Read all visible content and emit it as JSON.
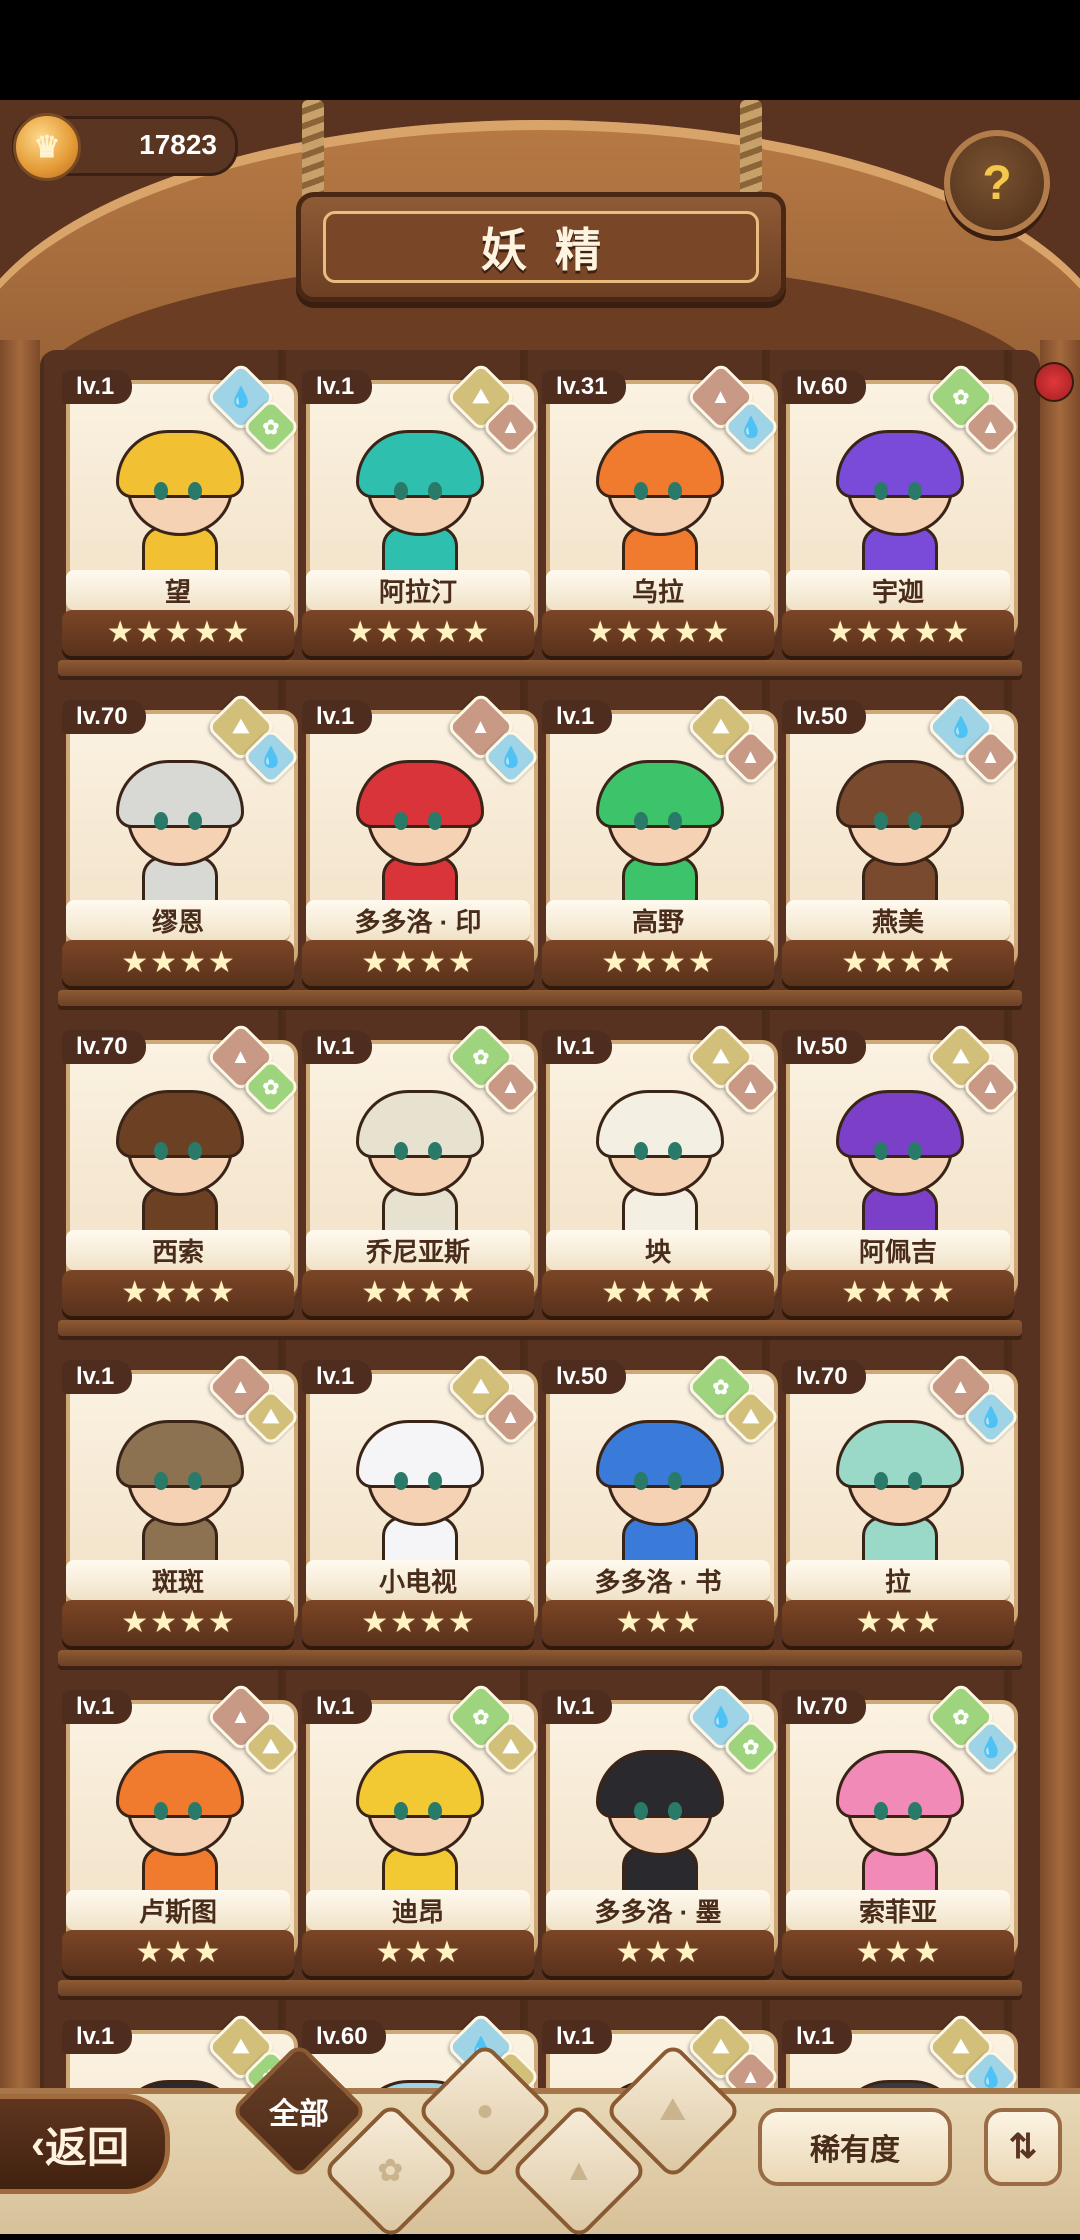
{
  "currency": {
    "value": "17823",
    "icon": "coin-icon"
  },
  "title": "妖精",
  "help": {
    "label": "?"
  },
  "fairies": [
    {
      "lv": "lv.1",
      "name": "望",
      "stars": 5,
      "hair": "#f2c033",
      "elem_big": "water",
      "elem_small": "plant"
    },
    {
      "lv": "lv.1",
      "name": "阿拉汀",
      "stars": 5,
      "hair": "#2fbfae",
      "elem_big": "earth",
      "elem_small": "mountain"
    },
    {
      "lv": "lv.31",
      "name": "乌拉",
      "stars": 5,
      "hair": "#f07a2e",
      "elem_big": "mountain",
      "elem_small": "water"
    },
    {
      "lv": "lv.60",
      "name": "宇迦",
      "stars": 5,
      "hair": "#7a4ad8",
      "elem_big": "plant",
      "elem_small": "mountain"
    },
    {
      "lv": "lv.70",
      "name": "缪恩",
      "stars": 4,
      "hair": "#d8d8d4",
      "elem_big": "earth",
      "elem_small": "water"
    },
    {
      "lv": "lv.1",
      "name": "多多洛 · 印",
      "stars": 4,
      "hair": "#d8343a",
      "elem_big": "mountain",
      "elem_small": "water"
    },
    {
      "lv": "lv.1",
      "name": "高野",
      "stars": 4,
      "hair": "#3dc46a",
      "elem_big": "earth",
      "elem_small": "mountain"
    },
    {
      "lv": "lv.50",
      "name": "燕美",
      "stars": 4,
      "hair": "#7a4a2e",
      "elem_big": "water",
      "elem_small": "mountain"
    },
    {
      "lv": "lv.70",
      "name": "西索",
      "stars": 4,
      "hair": "#6b4023",
      "elem_big": "mountain",
      "elem_small": "plant"
    },
    {
      "lv": "lv.1",
      "name": "乔尼亚斯",
      "stars": 4,
      "hair": "#e6e2cf",
      "elem_big": "plant",
      "elem_small": "mountain"
    },
    {
      "lv": "lv.1",
      "name": "坱",
      "stars": 4,
      "hair": "#f3efe2",
      "elem_big": "earth",
      "elem_small": "mountain"
    },
    {
      "lv": "lv.50",
      "name": "阿佩吉",
      "stars": 4,
      "hair": "#7b3fc8",
      "elem_big": "earth",
      "elem_small": "mountain"
    },
    {
      "lv": "lv.1",
      "name": "斑斑",
      "stars": 4,
      "hair": "#8c7250",
      "elem_big": "mountain",
      "elem_small": "earth"
    },
    {
      "lv": "lv.1",
      "name": "小电视",
      "stars": 4,
      "hair": "#f5f5f8",
      "elem_big": "earth",
      "elem_small": "mountain"
    },
    {
      "lv": "lv.50",
      "name": "多多洛 · 书",
      "stars": 3,
      "hair": "#3a7ad8",
      "elem_big": "plant",
      "elem_small": "earth"
    },
    {
      "lv": "lv.70",
      "name": "拉",
      "stars": 3,
      "hair": "#9ad8c8",
      "elem_big": "mountain",
      "elem_small": "water"
    },
    {
      "lv": "lv.1",
      "name": "卢斯图",
      "stars": 3,
      "hair": "#f07a2e",
      "elem_big": "mountain",
      "elem_small": "earth"
    },
    {
      "lv": "lv.1",
      "name": "迪昂",
      "stars": 3,
      "hair": "#f2c833",
      "elem_big": "plant",
      "elem_small": "earth"
    },
    {
      "lv": "lv.1",
      "name": "多多洛 · 墨",
      "stars": 3,
      "hair": "#2a2a2e",
      "elem_big": "water",
      "elem_small": "plant"
    },
    {
      "lv": "lv.70",
      "name": "索菲亚",
      "stars": 3,
      "hair": "#f28ab8",
      "elem_big": "plant",
      "elem_small": "water"
    },
    {
      "lv": "lv.1",
      "name": "",
      "stars": 0,
      "hair": "#2a2a2e",
      "elem_big": "earth",
      "elem_small": "plant"
    },
    {
      "lv": "lv.60",
      "name": "",
      "stars": 0,
      "hair": "#9fd3e6",
      "elem_big": "water",
      "elem_small": "earth"
    },
    {
      "lv": "lv.1",
      "name": "",
      "stars": 0,
      "hair": "#d8343a",
      "elem_big": "earth",
      "elem_small": "mountain"
    },
    {
      "lv": "lv.1",
      "name": "",
      "stars": 0,
      "hair": "#3a3a3e",
      "elem_big": "earth",
      "elem_small": "water"
    }
  ],
  "elements": {
    "water": {
      "color": "#9fd3e6",
      "glyph": "💧"
    },
    "earth": {
      "color": "#d2c07a",
      "glyph": "⛰"
    },
    "mountain": {
      "color": "#c89a86",
      "glyph": "▲"
    },
    "plant": {
      "color": "#9fd47e",
      "glyph": "✿"
    }
  },
  "bottom": {
    "back_label": "返回",
    "filters": [
      {
        "label": "全部",
        "active": true
      },
      {
        "label": "",
        "icon": "sprout-icon"
      },
      {
        "label": "",
        "icon": "water-drop-icon"
      },
      {
        "label": "",
        "icon": "earth-icon"
      },
      {
        "label": "",
        "icon": "mountain-icon"
      }
    ],
    "sort_label": "稀有度",
    "order_icon": "sort-order-icon"
  }
}
